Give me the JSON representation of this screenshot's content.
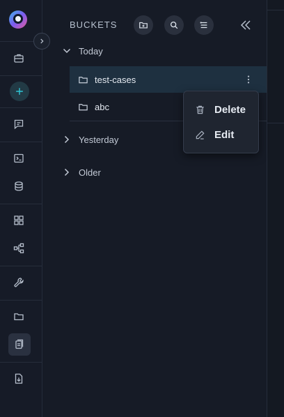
{
  "sidebar": {
    "icons": [
      "app-logo-icon",
      "briefcase-icon",
      "plus-icon",
      "chat-icon",
      "terminal-icon",
      "database-icon",
      "grid-icon",
      "workflow-icon",
      "wrench-icon",
      "folder-icon",
      "documents-icon",
      "file-download-icon"
    ],
    "active_item": "documents-icon"
  },
  "panel": {
    "title": "BUCKETS",
    "toolbar": [
      "new-folder-icon",
      "search-icon",
      "list-icon"
    ],
    "groups": [
      {
        "label": "Today",
        "expanded": true,
        "items": [
          {
            "name": "test-cases",
            "selected": true
          },
          {
            "name": "abc",
            "selected": false
          }
        ]
      },
      {
        "label": "Yesterday",
        "expanded": false
      },
      {
        "label": "Older",
        "expanded": false
      }
    ]
  },
  "context_menu": {
    "items": [
      {
        "label": "Delete",
        "icon": "trash-icon"
      },
      {
        "label": "Edit",
        "icon": "pencil-icon"
      }
    ]
  },
  "colors": {
    "accent": "#1e3040",
    "background": "#13171f",
    "panel": "#161b26"
  }
}
